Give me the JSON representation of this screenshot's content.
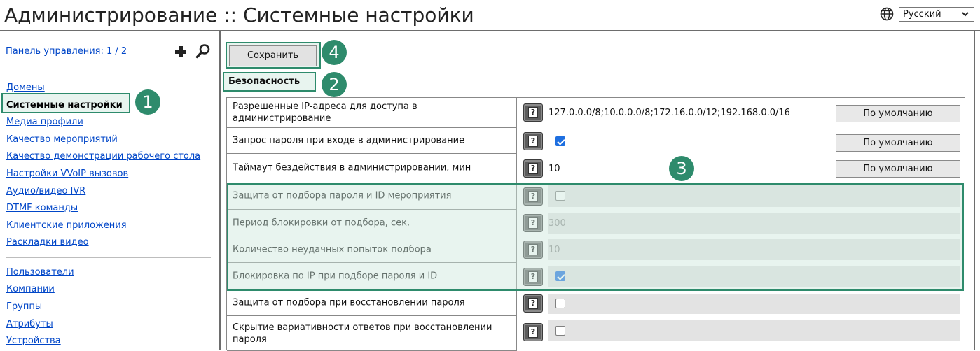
{
  "header": {
    "title": "Администрирование :: Системные настройки",
    "language": "Русский",
    "globe_icon": "globe-icon",
    "dropdown_icon": "chevron-down-icon"
  },
  "sidebar": {
    "panel_link": "Панель управления: 1 / 2",
    "add_icon": "plus-icon",
    "search_icon": "search-icon",
    "group1": [
      "Домены",
      "Системные настройки",
      "Медиа профили",
      "Качество мероприятий",
      "Качество демонстрации рабочего стола",
      "Настройки VVoIP вызовов",
      "Аудио/видео IVR",
      "DTMF команды",
      "Клиентские приложения",
      "Раскладки видео"
    ],
    "active_item": "Системные настройки",
    "group2": [
      "Пользователи",
      "Компании",
      "Группы",
      "Атрибуты",
      "Устройства"
    ]
  },
  "toolbar": {
    "save_label": "Сохранить"
  },
  "section": {
    "title": "Безопасность"
  },
  "help_label": "?",
  "settings": [
    {
      "label": "Разрешенные IP-адреса для доступа в администрирование",
      "type": "text",
      "value": "127.0.0.0/8;10.0.0.0/8;172.16.0.0/12;192.168.0.0/16",
      "default_button": "По умолчанию"
    },
    {
      "label": "Запрос пароля при входе в администрирование",
      "type": "checkbox",
      "checked": true,
      "default_button": "По умолчанию"
    },
    {
      "label": "Таймаут бездействия в администрировании, мин",
      "type": "text",
      "value": "10",
      "default_button": "По умолчанию"
    },
    {
      "label": "Защита от подбора пароля и ID мероприятия",
      "type": "checkbox",
      "checked": false
    },
    {
      "label": "Период блокировки от подбора, сек.",
      "type": "text",
      "value": "300",
      "disabled": true
    },
    {
      "label": "Количество неудачных попыток подбора",
      "type": "text",
      "value": "10",
      "disabled": true
    },
    {
      "label": "Блокировка по IP при подборе пароля и ID",
      "type": "checkbox",
      "checked": true
    },
    {
      "label": "Защита от подбора при восстановлении пароля",
      "type": "checkbox",
      "checked": false
    },
    {
      "label": "Скрытие вариативности ответов при восстановлении пароля",
      "type": "checkbox",
      "checked": false
    }
  ],
  "callouts": [
    "1",
    "2",
    "3",
    "4"
  ],
  "colors": {
    "accent": "#2e8b6c",
    "link": "#0046c8",
    "checkbox": "#1e6fe0"
  }
}
